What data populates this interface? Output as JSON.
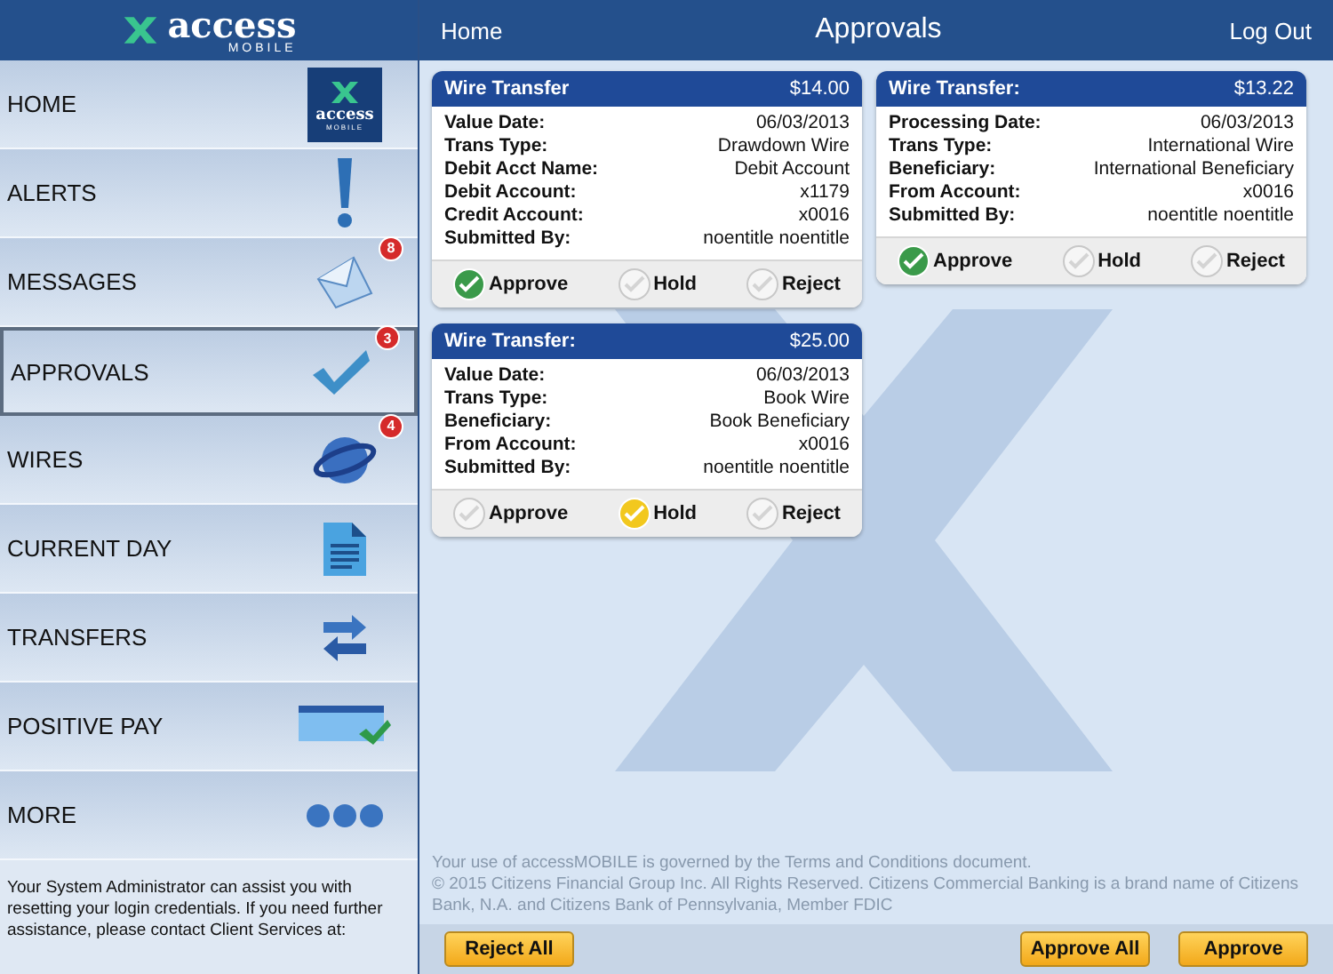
{
  "sidebar": {
    "logo": {
      "name": "access",
      "tagline": "MOBILE"
    },
    "items": [
      {
        "label": "HOME",
        "kind": "logo",
        "icon_text": "access",
        "icon_subtext": "MOBILE",
        "selected": false
      },
      {
        "label": "ALERTS",
        "kind": "alert",
        "selected": false
      },
      {
        "label": "MESSAGES",
        "kind": "mail",
        "badge": "8",
        "selected": false
      },
      {
        "label": "APPROVALS",
        "kind": "check",
        "badge": "3",
        "selected": true
      },
      {
        "label": "WIRES",
        "kind": "globe",
        "badge": "4",
        "selected": false
      },
      {
        "label": "CURRENT DAY",
        "kind": "doc",
        "selected": false
      },
      {
        "label": "TRANSFERS",
        "kind": "arrows",
        "selected": false
      },
      {
        "label": "POSITIVE PAY",
        "kind": "cheque",
        "selected": false
      },
      {
        "label": "MORE",
        "kind": "dots",
        "selected": false
      }
    ],
    "help_text": "Your System Administrator can assist you with resetting your login credentials. If you need further assistance, please contact Client Services at:"
  },
  "header": {
    "left": "Home",
    "title": "Approvals",
    "right": "Log Out"
  },
  "cards": [
    {
      "title": "Wire Transfer",
      "amount": "$14.00",
      "fields": [
        {
          "label": "Value Date:",
          "value": "06/03/2013"
        },
        {
          "label": "Trans Type:",
          "value": "Drawdown Wire"
        },
        {
          "label": "Debit Acct Name:",
          "value": "Debit Account"
        },
        {
          "label": "Debit Account:",
          "value": "x1179"
        },
        {
          "label": "Credit Account:",
          "value": "x0016"
        },
        {
          "label": "Submitted By:",
          "value": "noentitle noentitle"
        }
      ],
      "actions": [
        {
          "label": "Approve",
          "kind": "approve",
          "selected": true
        },
        {
          "label": "Hold",
          "kind": "hold",
          "selected": false
        },
        {
          "label": "Reject",
          "kind": "reject",
          "selected": false
        }
      ]
    },
    {
      "title": "Wire Transfer:",
      "amount": "$13.22",
      "fields": [
        {
          "label": "Processing Date:",
          "value": "06/03/2013"
        },
        {
          "label": "Trans Type:",
          "value": "International Wire"
        },
        {
          "label": "Beneficiary:",
          "value": "International Beneficiary"
        },
        {
          "label": "From Account:",
          "value": "x0016"
        },
        {
          "label": "Submitted By:",
          "value": "noentitle noentitle"
        }
      ],
      "actions": [
        {
          "label": "Approve",
          "kind": "approve",
          "selected": true
        },
        {
          "label": "Hold",
          "kind": "hold",
          "selected": false
        },
        {
          "label": "Reject",
          "kind": "reject",
          "selected": false
        }
      ]
    },
    {
      "title": "Wire Transfer:",
      "amount": "$25.00",
      "fields": [
        {
          "label": "Value Date:",
          "value": "06/03/2013"
        },
        {
          "label": "Trans Type:",
          "value": "Book Wire"
        },
        {
          "label": "Beneficiary:",
          "value": "Book Beneficiary"
        },
        {
          "label": "From Account:",
          "value": "x0016"
        },
        {
          "label": "Submitted By:",
          "value": "noentitle noentitle"
        }
      ],
      "actions": [
        {
          "label": "Approve",
          "kind": "approve",
          "selected": false
        },
        {
          "label": "Hold",
          "kind": "hold",
          "selected": true
        },
        {
          "label": "Reject",
          "kind": "reject",
          "selected": false
        }
      ]
    }
  ],
  "legal": [
    "Your use of accessMOBILE is governed by the Terms and Conditions document.",
    "© 2015 Citizens Financial Group Inc. All Rights Reserved. Citizens Commercial Banking is a brand name of Citizens Bank, N.A. and Citizens Bank of Pennsylvania, Member FDIC"
  ],
  "bottom_bar": {
    "left_buttons": [
      "Reject All"
    ],
    "right_buttons": [
      "Approve All",
      "Approve"
    ]
  }
}
